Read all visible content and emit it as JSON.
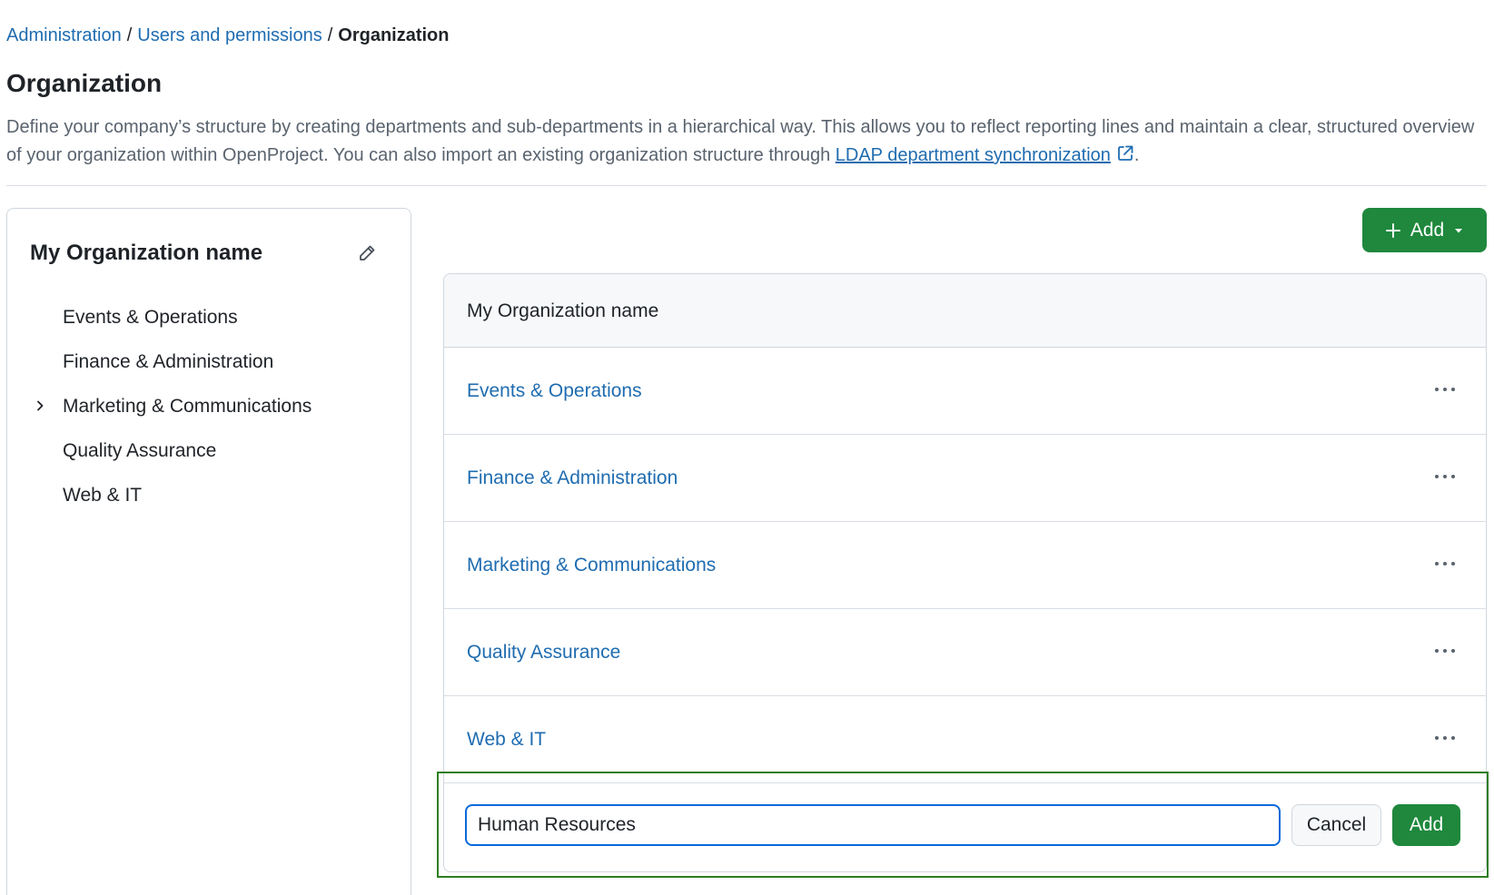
{
  "breadcrumb": {
    "items": [
      "Administration",
      "Users and permissions"
    ],
    "current": "Organization",
    "separator": "/"
  },
  "page": {
    "title": "Organization",
    "description_before": "Define your company’s structure by creating departments and sub-departments in a hierarchical way. This allows you to reflect reporting lines and maintain a clear, structured overview of your organization within OpenProject. You can also import an existing organization structure through ",
    "description_link": "LDAP department synchronization",
    "description_after": "."
  },
  "sidebar": {
    "org_name": "My Organization name",
    "edit_icon": "pencil-icon",
    "items": [
      {
        "label": "Events & Operations"
      },
      {
        "label": "Finance & Administration"
      },
      {
        "label": "Marketing & Communications",
        "expandable": true
      },
      {
        "label": "Quality Assurance"
      },
      {
        "label": "Web & IT"
      }
    ]
  },
  "toolbar": {
    "add_label": "Add",
    "add_icon": "plus-icon",
    "dropdown_icon": "triangle-down-icon"
  },
  "list": {
    "header": "My Organization name",
    "rows": [
      {
        "label": "Events & Operations"
      },
      {
        "label": "Finance & Administration"
      },
      {
        "label": "Marketing & Communications"
      },
      {
        "label": "Quality Assurance"
      },
      {
        "label": "Web & IT"
      }
    ],
    "row_menu_icon": "kebab-horizontal-icon"
  },
  "add_form": {
    "input_value": "Human Resources",
    "cancel_label": "Cancel",
    "submit_label": "Add"
  },
  "colors": {
    "link": "#1f6cb0",
    "primary_button": "#1f883d",
    "focus_border": "#0969da",
    "highlight_border": "#2e7d1f"
  }
}
